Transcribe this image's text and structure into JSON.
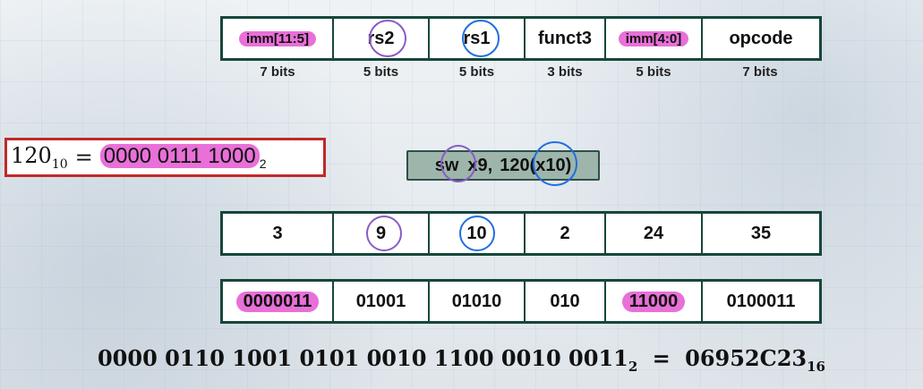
{
  "header": {
    "fields": [
      "imm[11:5]",
      "rs2",
      "rs1",
      "funct3",
      "imm[4:0]",
      "opcode"
    ],
    "sizes": [
      "7 bits",
      "5 bits",
      "5 bits",
      "3 bits",
      "5 bits",
      "7 bits"
    ]
  },
  "imm_equation": {
    "decimal": "120",
    "decimal_base": "10",
    "equals": "=",
    "binary": "0000 0111 1000",
    "binary_base": "2"
  },
  "instruction": {
    "mnemonic": "sw",
    "rs2": "x9",
    "separator": ",",
    "offset": "120",
    "rs1": "x10",
    "close": ")"
  },
  "decimal_row": [
    "3",
    "9",
    "10",
    "2",
    "24",
    "35"
  ],
  "binary_row": [
    "0000011",
    "01001",
    "01010",
    "010",
    "11000",
    "0100011"
  ],
  "result": {
    "binary": "0000 0110 1001 0101 0010 1100 0010 0011",
    "binary_base": "2",
    "equals": "=",
    "hex": "06952C23",
    "hex_base": "16"
  },
  "colors": {
    "highlight": "#e870d8",
    "rs2_ring": "#8a5bc7",
    "rs1_ring": "#1f6fe0",
    "table_border": "#17463b",
    "imm_box_border": "#c02a2a",
    "instruction_box": "#9eb5ab"
  }
}
